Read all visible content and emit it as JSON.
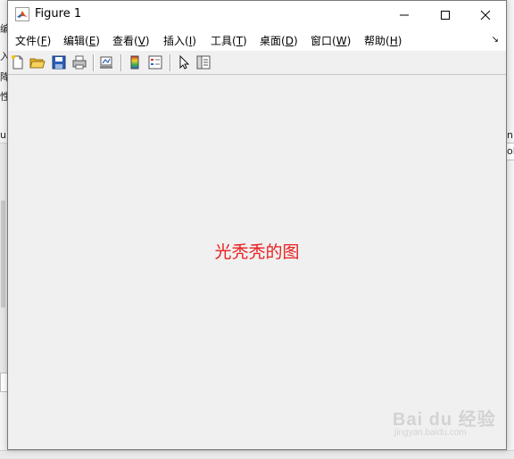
{
  "window": {
    "title": "Figure 1"
  },
  "menu": {
    "items": [
      {
        "label": "文件(",
        "mnemonic": "F",
        "close": ")"
      },
      {
        "label": "编辑(",
        "mnemonic": "E",
        "close": ")"
      },
      {
        "label": "查看(",
        "mnemonic": "V",
        "close": ")"
      },
      {
        "label": "插入(",
        "mnemonic": "I",
        "close": ")"
      },
      {
        "label": "工具(",
        "mnemonic": "T",
        "close": ")"
      },
      {
        "label": "桌面(",
        "mnemonic": "D",
        "close": ")"
      },
      {
        "label": "窗口(",
        "mnemonic": "W",
        "close": ")"
      },
      {
        "label": "帮助(",
        "mnemonic": "H",
        "close": ")"
      }
    ],
    "overflow_icon": "↘"
  },
  "toolbar": {
    "icons": [
      "new-figure-icon",
      "open-file-icon",
      "save-icon",
      "print-icon",
      "link-plot-icon",
      "colorbar-icon",
      "legend-icon",
      "edit-plot-icon",
      "property-inspector-icon"
    ]
  },
  "figure": {
    "text": "光秃秃的图",
    "text_color": "#e81e1e"
  },
  "background": {
    "left_glyphs": [
      "编",
      "入",
      "降",
      "性",
      "un"
    ],
    "right_glyphs": [
      "n",
      "ol"
    ]
  },
  "watermark": {
    "brand": "Bai du 经验",
    "url": "jingyan.baidu.com"
  }
}
